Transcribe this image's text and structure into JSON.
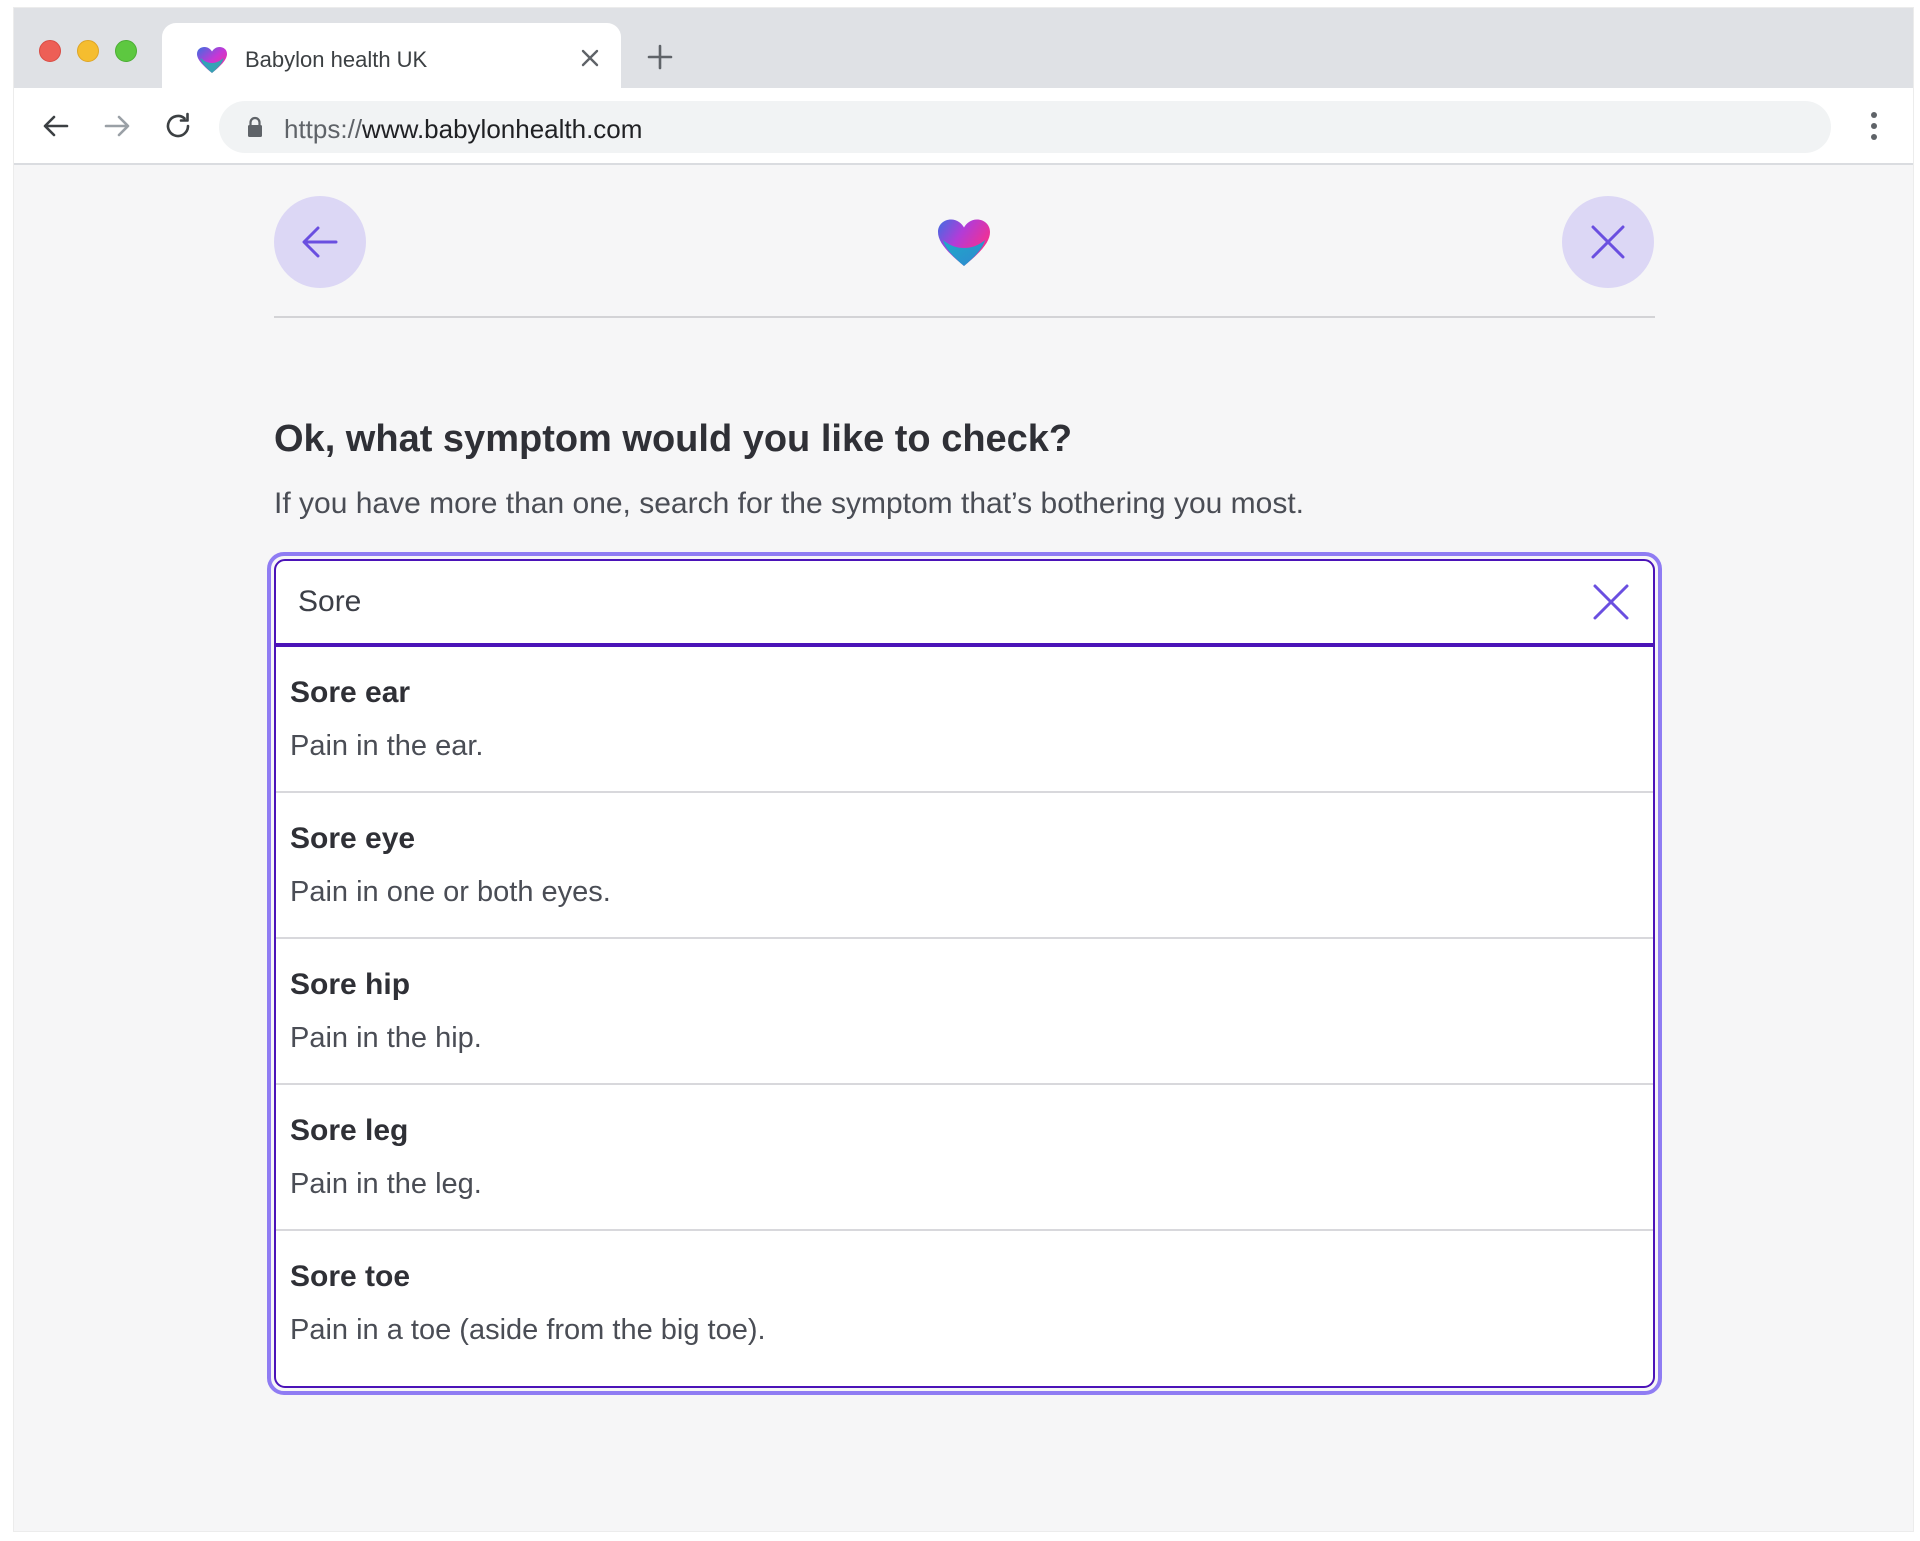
{
  "browser": {
    "tab_title": "Babylon health UK",
    "url_scheme": "https://",
    "url_host": "www.babylonhealth.com"
  },
  "colors": {
    "accent": "#6a4fe0",
    "accent_dark": "#4b13b8",
    "focus_ring": "#8f7cf3",
    "button_bg": "#dcd7f5"
  },
  "header": {
    "back_icon": "arrow-left-icon",
    "close_icon": "close-icon",
    "logo_icon": "heart-logo-icon"
  },
  "main": {
    "question": "Ok, what symptom would you like to check?",
    "hint": "If you have more than one, search for the symptom that’s bothering you most."
  },
  "search": {
    "value": "Sore",
    "results": [
      {
        "title": "Sore ear",
        "description": "Pain in the ear."
      },
      {
        "title": "Sore eye",
        "description": "Pain in one or both eyes."
      },
      {
        "title": "Sore hip",
        "description": "Pain in the hip."
      },
      {
        "title": "Sore leg",
        "description": "Pain in the leg."
      },
      {
        "title": "Sore toe",
        "description": "Pain in a toe (aside from the big toe)."
      }
    ]
  }
}
